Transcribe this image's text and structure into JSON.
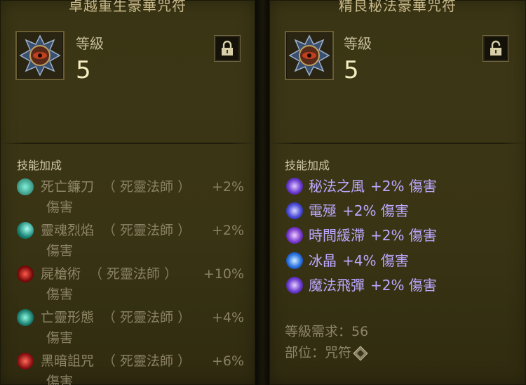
{
  "left": {
    "title": "卓越重生豪華咒符",
    "level_label": "等級",
    "level_value": "5",
    "section_title": "技能加成",
    "skills": [
      {
        "name": "死亡鐮刀",
        "class": "（ 死靈法師 ）",
        "bonus": "+2%",
        "dmg": "傷害",
        "icon": "scythe-icon",
        "color": "#2a8f7a"
      },
      {
        "name": "靈魂烈焰",
        "class": "（ 死靈法師 ）",
        "bonus": "+2%",
        "dmg": "傷害",
        "icon": "soul-flame-icon",
        "color": "#1fa08a"
      },
      {
        "name": "屍槍術",
        "class": "（ 死靈法師 ）",
        "bonus": "+10%",
        "dmg": "傷害",
        "icon": "corpse-lance-icon",
        "color": "#8a1414"
      },
      {
        "name": "亡靈形態",
        "class": "（ 死靈法師 ）",
        "bonus": "+4%",
        "dmg": "傷害",
        "icon": "undead-form-icon",
        "color": "#1f8f80"
      },
      {
        "name": "黑暗詛咒",
        "class": "（ 死靈法師 ）",
        "bonus": "+6%",
        "dmg": "傷害",
        "icon": "dark-curse-icon",
        "color": "#9a1a1a"
      }
    ]
  },
  "right": {
    "title": "精良秘法豪華咒符",
    "level_label": "等級",
    "level_value": "5",
    "section_title": "技能加成",
    "skills": [
      {
        "name": "秘法之風",
        "bonus": "+2% 傷害",
        "icon": "arcane-wind-icon",
        "color": "#6a3fd0"
      },
      {
        "name": "電殛",
        "bonus": "+2% 傷害",
        "icon": "shock-icon",
        "color": "#5a4ad8"
      },
      {
        "name": "時間緩滯",
        "bonus": "+2% 傷害",
        "icon": "time-slow-icon",
        "color": "#8a4ad8"
      },
      {
        "name": "冰晶",
        "bonus": "+4% 傷害",
        "icon": "ice-crystal-icon",
        "color": "#3a7ae0"
      },
      {
        "name": "魔法飛彈",
        "bonus": "+2% 傷害",
        "icon": "magic-missile-icon",
        "color": "#7a4ad8"
      }
    ],
    "level_requirement": "等級需求：56",
    "slot": "部位：咒符"
  },
  "colors": {
    "panel_bg": "#3a3514",
    "title": "#c9b98a",
    "skill_purple": "#bba8ff",
    "level_value": "#f5ecc0"
  }
}
